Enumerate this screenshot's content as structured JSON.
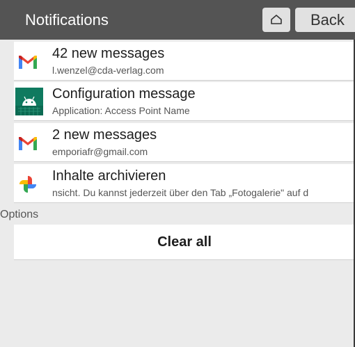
{
  "header": {
    "title": "Notifications",
    "home_icon": "home-icon",
    "back_label": "Back"
  },
  "notifications": [
    {
      "app_icon": "gmail-icon",
      "title": "42 new messages",
      "subtitle": "l.wenzel@cda-verlag.com"
    },
    {
      "app_icon": "android-icon",
      "title": "Configuration message",
      "subtitle": "Application: Access Point Name"
    },
    {
      "app_icon": "gmail-icon",
      "title": "2 new messages",
      "subtitle": "emporiafr@gmail.com"
    },
    {
      "app_icon": "google-photos-icon",
      "title": "Inhalte archivieren",
      "subtitle": "nsicht. Du kannst jederzeit über den Tab „Fotogalerie\" auf d"
    }
  ],
  "options": {
    "label": "Options",
    "clear_all_label": "Clear all"
  },
  "colors": {
    "header_bg": "#545454",
    "page_bg": "#ebebeb",
    "card_bg": "#ffffff",
    "android_green": "#0f7a5f"
  }
}
